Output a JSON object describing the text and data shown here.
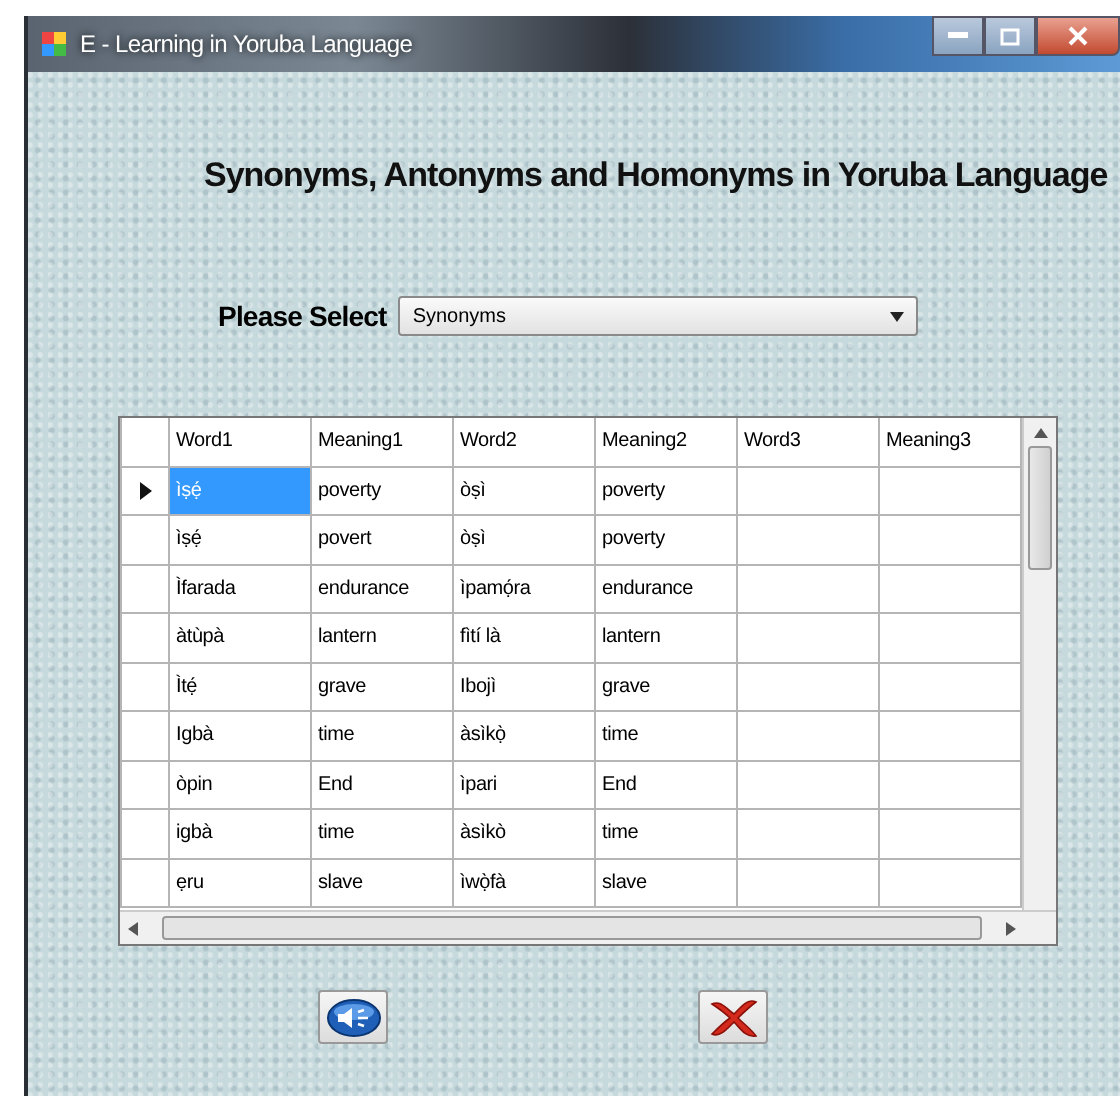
{
  "window": {
    "title": "E - Learning in Yoruba Language"
  },
  "heading": "Synonyms, Antonyms and Homonyms in Yoruba Language",
  "select": {
    "label": "Please Select",
    "value": "Synonyms"
  },
  "table": {
    "columns": [
      "Word1",
      "Meaning1",
      "Word2",
      "Meaning2",
      "Word3",
      "Meaning3"
    ],
    "rows": [
      {
        "selected": true,
        "cells": [
          "ìṣẹ́",
          "poverty",
          "òṣì",
          "poverty",
          "",
          ""
        ]
      },
      {
        "selected": false,
        "cells": [
          "ìṣẹ́",
          "povert",
          "òṣì",
          "poverty",
          "",
          ""
        ]
      },
      {
        "selected": false,
        "cells": [
          "Ìfarada",
          "endurance",
          "ìpamọ́ra",
          "endurance",
          "",
          ""
        ]
      },
      {
        "selected": false,
        "cells": [
          "àtùpà",
          "lantern",
          "fìtí là",
          "lantern",
          "",
          ""
        ]
      },
      {
        "selected": false,
        "cells": [
          "Ìtẹ́",
          "grave",
          "Ibojì",
          "grave",
          "",
          ""
        ]
      },
      {
        "selected": false,
        "cells": [
          "Igbà",
          "time",
          "àsìkọ̀",
          "time",
          "",
          ""
        ]
      },
      {
        "selected": false,
        "cells": [
          "òpin",
          "End",
          "ìpari",
          "End",
          "",
          ""
        ]
      },
      {
        "selected": false,
        "cells": [
          "igbà",
          "time",
          "àsìkò",
          "time",
          "",
          ""
        ]
      },
      {
        "selected": false,
        "cells": [
          "ẹru",
          "slave",
          "ìwọ̀fà",
          "slave",
          "",
          ""
        ]
      }
    ]
  }
}
